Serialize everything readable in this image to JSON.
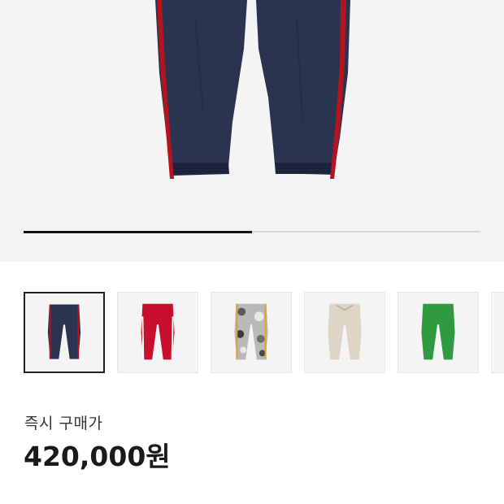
{
  "product": {
    "hero_image": "navy-track-pants-with-red-side-stripes",
    "carousel_progress": 0.5
  },
  "thumbnails": [
    {
      "icon": "pants-navy-icon",
      "color": "#2a3350",
      "stripe": "#b3141f",
      "selected": true
    },
    {
      "icon": "pants-red-icon",
      "color": "#c8102e",
      "stripe": "#ffffff",
      "selected": false
    },
    {
      "icon": "pants-camo-icon",
      "color": "#9a9a9a",
      "stripe": "#d8a526",
      "selected": false
    },
    {
      "icon": "pants-beige-icon",
      "color": "#ddd5c6",
      "stripe": "#ddd5c6",
      "selected": false
    },
    {
      "icon": "pants-green-icon",
      "color": "#2f9a3f",
      "stripe": "#2f9a3f",
      "selected": false
    }
  ],
  "price": {
    "label": "즉시 구매가",
    "value": "420,000원"
  },
  "colors": {
    "hero_bg": "#f4f4f4",
    "pants_navy": "#2a3350",
    "stripe_red": "#b3141f",
    "progress_fill": "#111111",
    "progress_track": "#d6d6d6"
  }
}
